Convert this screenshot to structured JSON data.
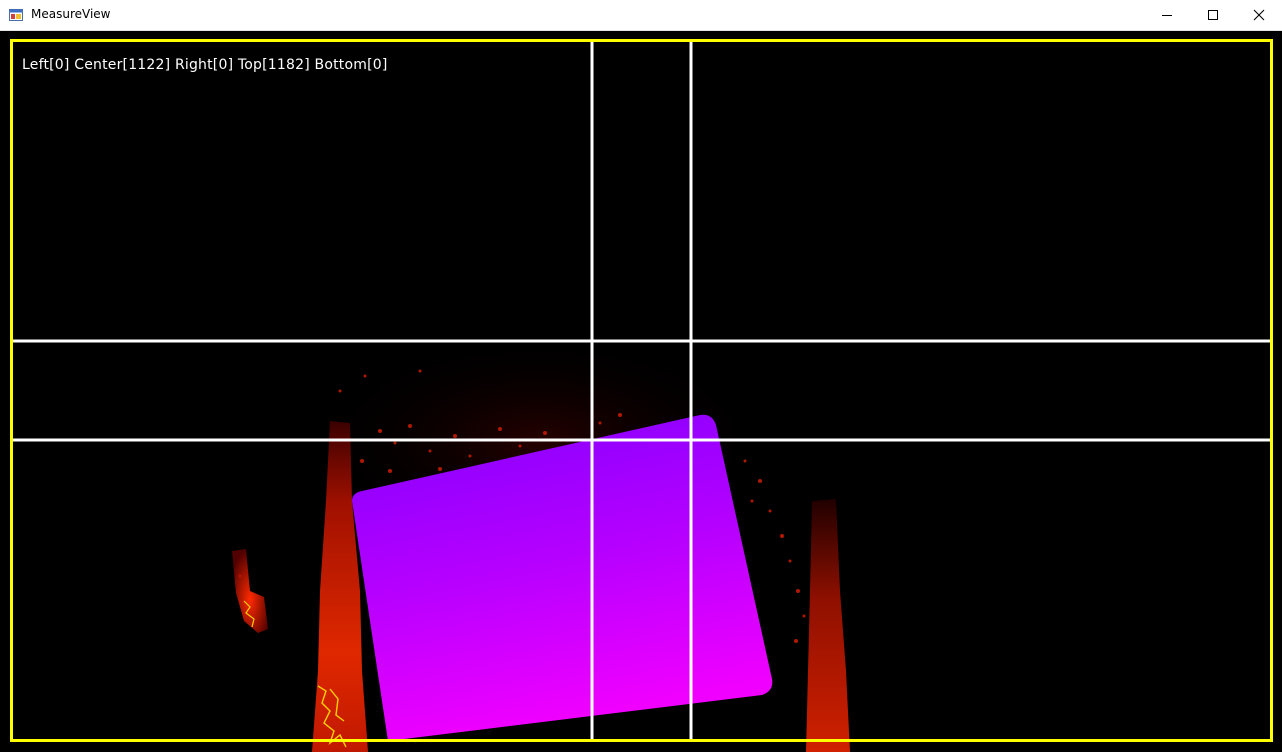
{
  "window": {
    "title": "MeasureView",
    "icon": "app-window-icon",
    "controls": [
      "minimize-icon",
      "maximize-icon",
      "close-icon"
    ]
  },
  "viewport": {
    "border_color": "#ffff00",
    "guide_line_color": "#ffffff",
    "object_color_top": "#8a00ff",
    "object_color_bottom": "#ee00ff",
    "heat_color": "#e02000"
  },
  "measurement": {
    "readout": "Left[0] Center[1122] Right[0] Top[1182] Bottom[0]"
  }
}
